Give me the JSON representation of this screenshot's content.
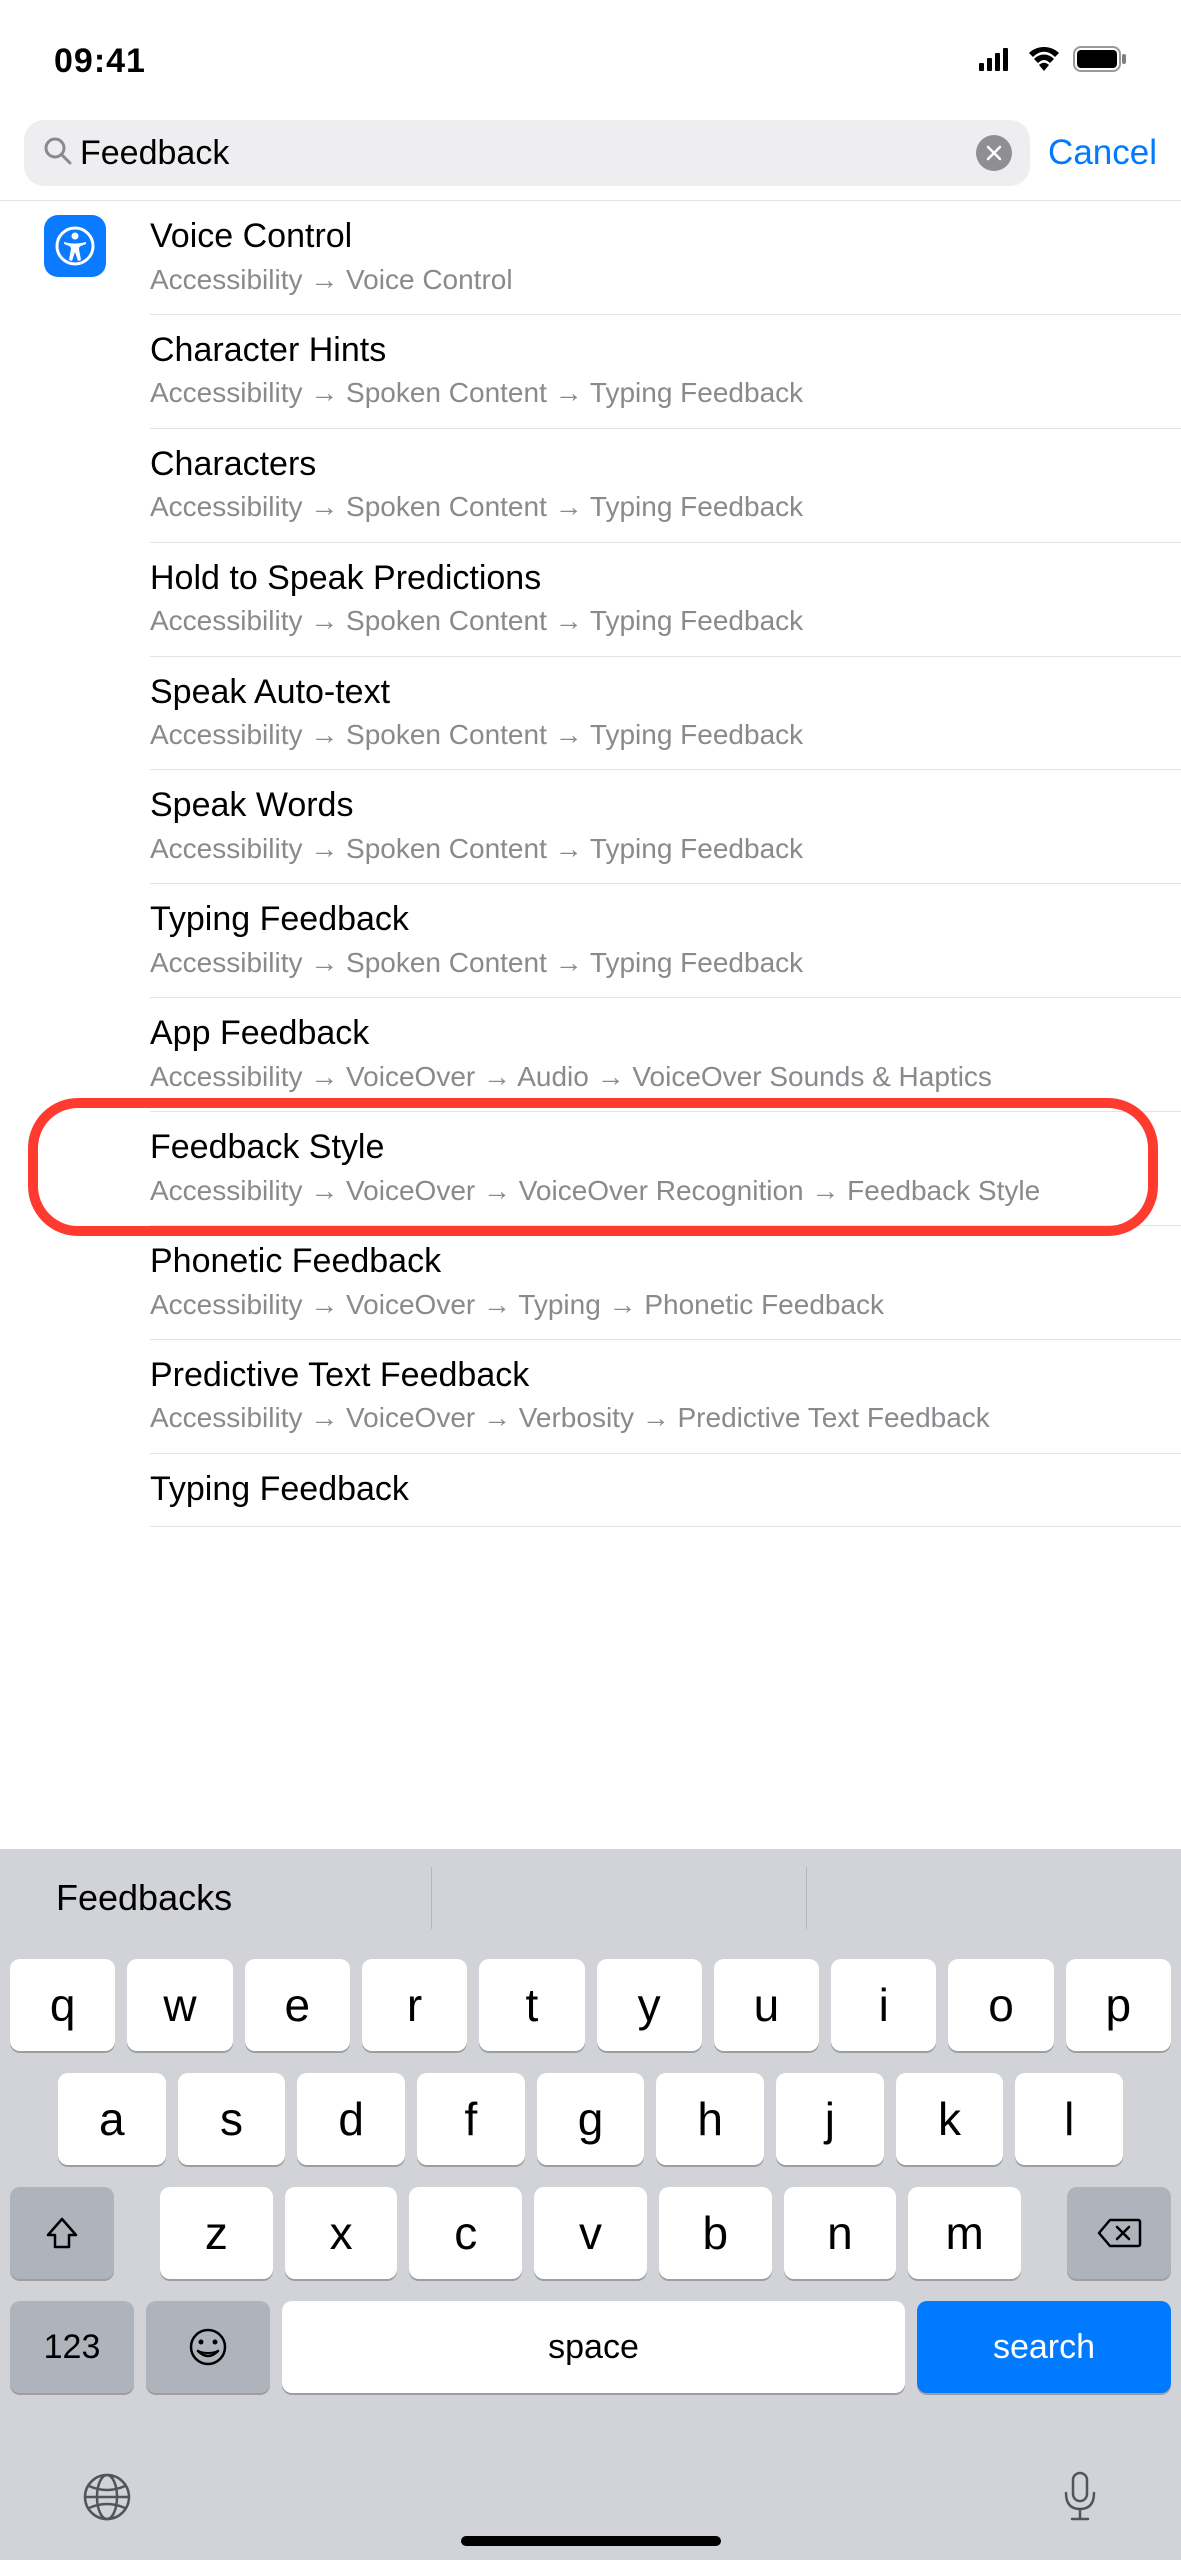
{
  "status": {
    "time": "09:41"
  },
  "search": {
    "value": "Feedback",
    "cancel": "Cancel"
  },
  "results": [
    {
      "title": "Voice Control",
      "path": "Accessibility → Voice Control"
    },
    {
      "title": "Character Hints",
      "path": "Accessibility → Spoken Content → Typing Feedback"
    },
    {
      "title": "Characters",
      "path": "Accessibility → Spoken Content → Typing Feedback"
    },
    {
      "title": "Hold to Speak Predictions",
      "path": "Accessibility → Spoken Content → Typing Feedback"
    },
    {
      "title": "Speak Auto-text",
      "path": "Accessibility → Spoken Content → Typing Feedback"
    },
    {
      "title": "Speak Words",
      "path": "Accessibility → Spoken Content → Typing Feedback"
    },
    {
      "title": "Typing Feedback",
      "path": "Accessibility → Spoken Content → Typing Feedback"
    },
    {
      "title": "App Feedback",
      "path": "Accessibility → VoiceOver → Audio → VoiceOver Sounds & Haptics"
    },
    {
      "title": "Feedback Style",
      "path": "Accessibility → VoiceOver → VoiceOver Recognition → Feedback Style"
    },
    {
      "title": "Phonetic Feedback",
      "path": "Accessibility → VoiceOver → Typing → Phonetic Feedback"
    },
    {
      "title": "Predictive Text Feedback",
      "path": "Accessibility → VoiceOver → Verbosity → Predictive Text Feedback"
    },
    {
      "title": "Typing Feedback",
      "path": ""
    }
  ],
  "highlighted_index": 8,
  "keyboard": {
    "suggestion": "Feedbacks",
    "row1": [
      "q",
      "w",
      "e",
      "r",
      "t",
      "y",
      "u",
      "i",
      "o",
      "p"
    ],
    "row2": [
      "a",
      "s",
      "d",
      "f",
      "g",
      "h",
      "j",
      "k",
      "l"
    ],
    "row3": [
      "z",
      "x",
      "c",
      "v",
      "b",
      "n",
      "m"
    ],
    "num_key": "123",
    "space": "space",
    "action": "search"
  }
}
